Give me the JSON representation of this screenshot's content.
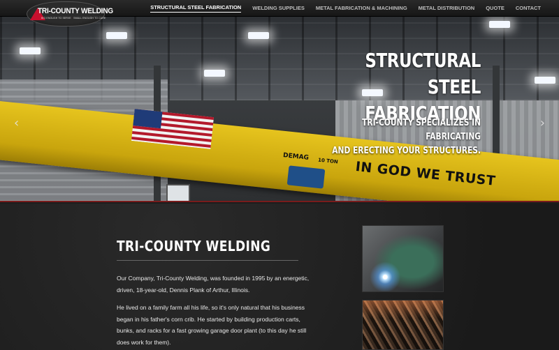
{
  "logo": {
    "name": "TRI-COUNTY WELDING",
    "tagline_left": "BIG ENOUGH TO SERVE",
    "tagline_right": "SMALL ENOUGH TO CARE"
  },
  "nav": {
    "items": [
      {
        "label": "STRUCTURAL STEEL FABRICATION",
        "active": true
      },
      {
        "label": "WELDING SUPPLIES",
        "active": false
      },
      {
        "label": "METAL FABRICATION & MACHINING",
        "active": false
      },
      {
        "label": "METAL DISTRIBUTION",
        "active": false
      },
      {
        "label": "QUOTE",
        "active": false
      },
      {
        "label": "CONTACT",
        "active": false
      }
    ]
  },
  "hero": {
    "title_line1": "STRUCTURAL STEEL",
    "title_line2": "FABRICATION",
    "subtitle_line1": "TRI-COUNTY SPECIALIZES IN FABRICATING",
    "subtitle_line2": "AND ERECTING YOUR STRUCTURES.",
    "prev_arrow": "‹",
    "next_arrow": "›",
    "photo_text": {
      "brand": "DEMAG",
      "capacity": "10 TON",
      "motto": "IN GOD WE TRUST"
    },
    "colors": {
      "beam": "#d9b815",
      "accent": "#c8102e"
    }
  },
  "about": {
    "title": "TRI-COUNTY WELDING",
    "paragraph1": "Our Company, Tri-County Welding, was founded in 1995 by an energetic, driven, 18-year-old, Dennis Plank of Arthur, Illinois.",
    "paragraph2": "He lived on a family farm all his life, so it's only natural that his business began in his father's corn crib. He started by building production carts, bunks, and racks for a fast growing garage door plant (to this day he still does work for them)."
  }
}
